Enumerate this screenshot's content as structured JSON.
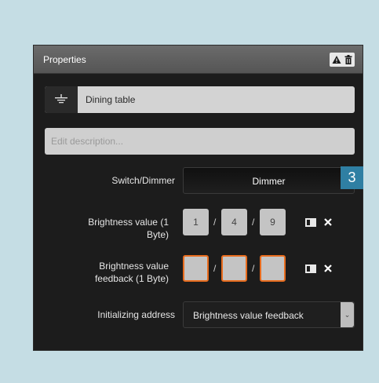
{
  "panel": {
    "title": "Properties",
    "header_icons": [
      "warning-icon",
      "trash-icon"
    ]
  },
  "name_field": {
    "icon": "outlet-icon",
    "value": "Dining table"
  },
  "description": {
    "placeholder": "Edit description..."
  },
  "switch_dimmer": {
    "label": "Switch/Dimmer",
    "value": "Dimmer",
    "caret": "-"
  },
  "brightness": {
    "label_line1": "Brightness value (1",
    "label_line2": "Byte)",
    "address": [
      "1",
      "4",
      "9"
    ],
    "separator": "/"
  },
  "feedback": {
    "label_line1": "Brightness value",
    "label_line2": "feedback (1 Byte)",
    "address": [
      "",
      "",
      ""
    ],
    "separator": "/"
  },
  "initializing": {
    "label": "Initializing address",
    "value": "Brightness value feedback",
    "arrow": "⌄"
  },
  "step_badge": "3",
  "colors": {
    "background": "#c5dde4",
    "panel": "#1c1c1c",
    "header": "#606060",
    "accent_border": "#e86c1e",
    "badge": "#2f7fa3"
  }
}
